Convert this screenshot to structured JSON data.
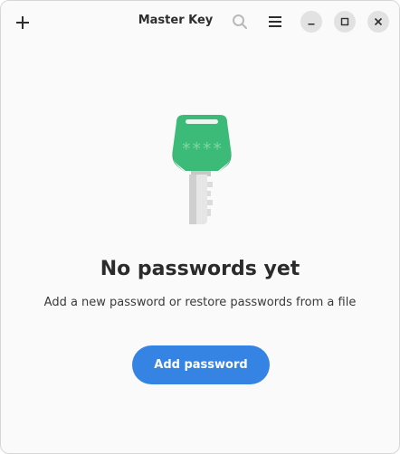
{
  "header": {
    "title": "Master Key",
    "icons": {
      "add": "plus-icon",
      "search": "search-icon",
      "menu": "hamburger-menu-icon",
      "minimize": "minimize-icon",
      "maximize": "maximize-icon",
      "close": "close-icon"
    }
  },
  "empty_state": {
    "illustration": "key-icon",
    "key_label": "****",
    "title": "No passwords yet",
    "description": "Add a new password or restore passwords from a file",
    "button_label": "Add password"
  },
  "colors": {
    "accent": "#3584e4",
    "key_green": "#3bba78",
    "background": "#fafafa"
  }
}
